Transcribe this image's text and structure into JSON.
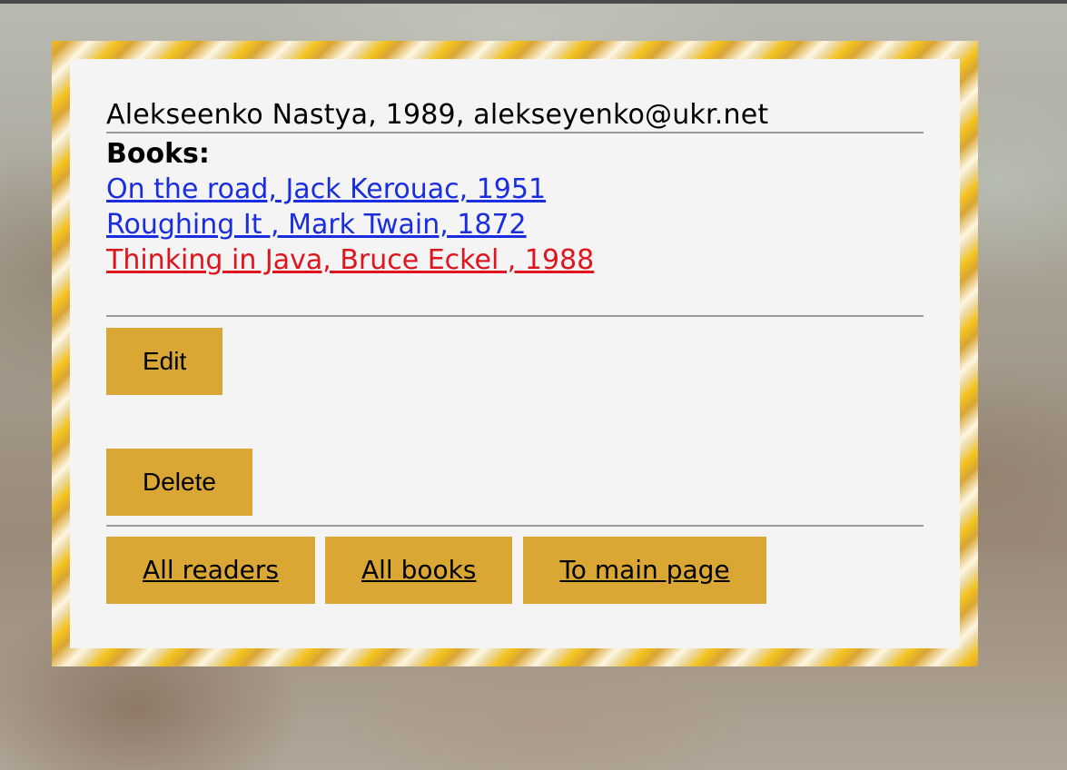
{
  "reader": {
    "info": "Alekseenko Nastya, 1989, alekseyenko@ukr.net"
  },
  "books": {
    "heading": "Books:",
    "items": [
      {
        "label": "On the road, Jack Kerouac, 1951",
        "color": "#1a2ee0"
      },
      {
        "label": "Roughing It , Mark Twain, 1872",
        "color": "#1a2ee0"
      },
      {
        "label": "Thinking in Java, Bruce Eckel , 1988",
        "color": "#e0141c"
      }
    ]
  },
  "actions": {
    "edit_label": "Edit",
    "delete_label": "Delete"
  },
  "nav": {
    "all_readers_label": "All readers",
    "all_books_label": "All books",
    "main_page_label": "To main page"
  },
  "colors": {
    "button": "#dba734",
    "card": "#f4f4f4",
    "link": "#1a2ee0",
    "link_overdue": "#e0141c"
  }
}
